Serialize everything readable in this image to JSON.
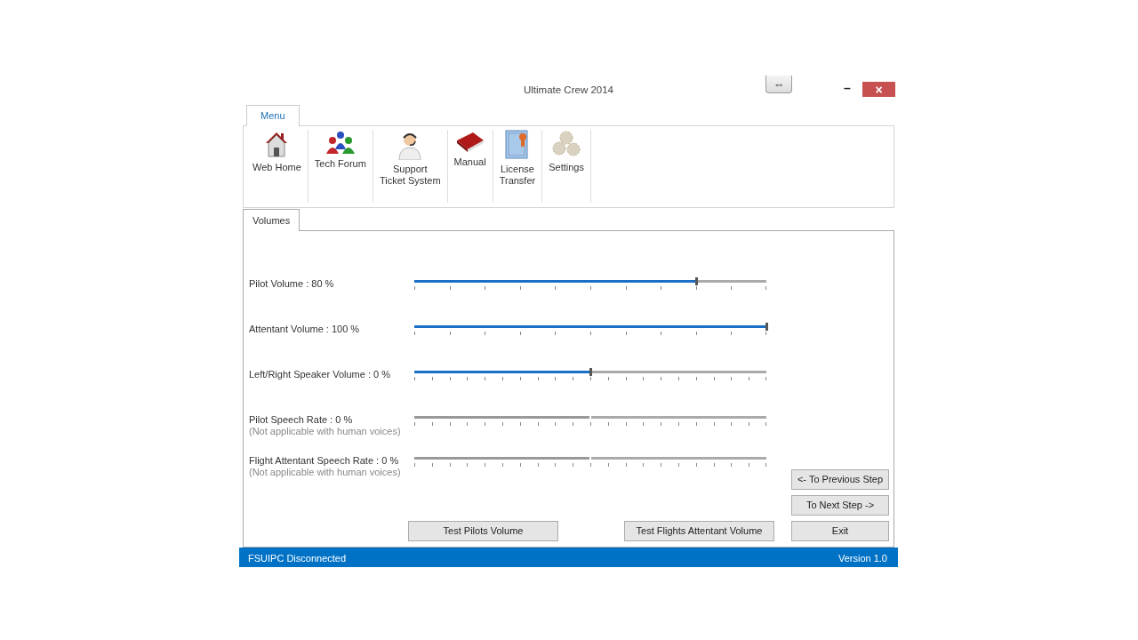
{
  "window": {
    "title": "Ultimate Crew 2014",
    "resize_button": "⇔",
    "minimize_button": "–",
    "close_button": "×"
  },
  "ribbon": {
    "tabs": [
      {
        "label": "Menu",
        "selected": true
      }
    ],
    "items": [
      {
        "label": "Web Home",
        "kind": "house"
      },
      {
        "label": "Tech Forum",
        "kind": "people"
      },
      {
        "label": "Support\nTicket System",
        "kind": "support"
      },
      {
        "label": "Manual",
        "kind": "pdf"
      },
      {
        "label": "License\nTransfer",
        "kind": "certificate"
      },
      {
        "label": "Settings",
        "kind": "gears"
      }
    ]
  },
  "page_tabs": [
    {
      "label": "Volumes",
      "selected": true
    }
  ],
  "sliders": [
    {
      "label": "Pilot Volume : 80 %",
      "kind": "volume",
      "level": 0.8,
      "disabled": false
    },
    {
      "label": "Attentant Volume : 100 %",
      "kind": "volume",
      "level": 1.0,
      "disabled": false
    },
    {
      "label": "Left/Right Speaker Volume : 0 %",
      "kind": "balance",
      "level": 0.5,
      "disabled": false
    },
    {
      "label": "Pilot Speech Rate : 0 %",
      "note": "(Not applicable with human voices)",
      "kind": "rate",
      "level": 0.5,
      "disabled": true
    },
    {
      "label": "Flight Attentant Speech Rate : 0 %",
      "note": "(Not applicable with human voices)",
      "kind": "rate",
      "level": 0.5,
      "disabled": true
    }
  ],
  "test_buttons": [
    "Test Pilots Volume",
    "Test Flights Attentant Volume"
  ],
  "nav_buttons": [
    "<- To Previous Step",
    "To Next Step ->",
    "Exit"
  ],
  "status_bar": {
    "left": "FSUIPC Disconnected",
    "right": "Version 1.0"
  }
}
